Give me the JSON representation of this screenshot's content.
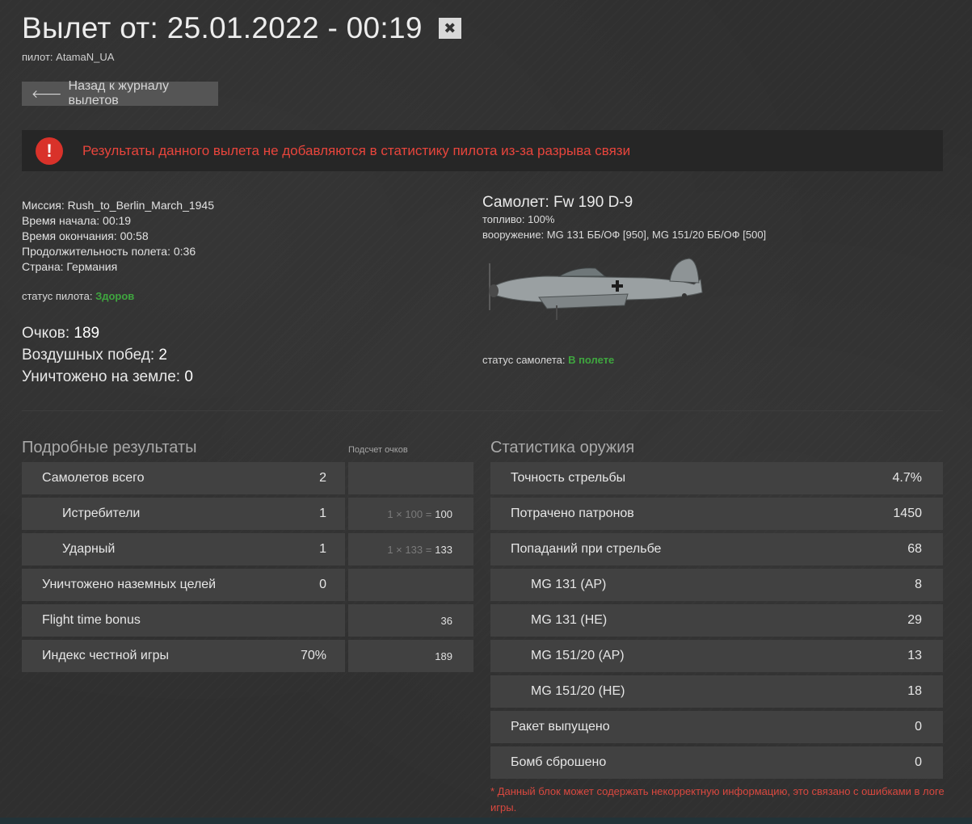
{
  "header": {
    "title": "Вылет от: 25.01.2022 - 00:19",
    "close_glyph": "✖",
    "pilot": "пилот: AtamaN_UA"
  },
  "back_button": {
    "label": "Назад к журналу вылетов",
    "icon": "arrow-left-icon"
  },
  "alert": {
    "icon": "exclamation-icon",
    "text": "Результаты данного вылета не добавляются в статистику пилота из-за разрыва связи",
    "color": "#e8453c"
  },
  "mission": {
    "lines": [
      "Миссия: Rush_to_Berlin_March_1945",
      "Время начала: 00:19",
      "Время окончания: 00:58",
      "Продолжительность полета: 0:36",
      "Страна: Германия"
    ],
    "pilot_status_label": "статус пилота: ",
    "pilot_status_value": "Здоров"
  },
  "summary": {
    "points_label": "Очков: ",
    "points_value": "189",
    "air_kills_label": "Воздушных побед: ",
    "air_kills_value": "2",
    "ground_kills_label": "Уничтожено на земле: ",
    "ground_kills_value": "0"
  },
  "plane": {
    "title": "Самолет: Fw 190 D-9",
    "fuel": "топливо: 100%",
    "armament": "вооружение: MG 131 ББ/ОФ [950], MG 151/20 ББ/ОФ [500]",
    "status_label": "статус самолета: ",
    "status_value": "В полете"
  },
  "results": {
    "title": "Подробные результаты",
    "points_header": "Подсчет очков",
    "rows": [
      {
        "label": "Самолетов всего",
        "value": "2",
        "formula": "",
        "points": ""
      },
      {
        "label": "Истребители",
        "value": "1",
        "formula": "1 × 100 =",
        "points": "100"
      },
      {
        "label": "Ударный",
        "value": "1",
        "formula": "1 × 133 =",
        "points": "133"
      },
      {
        "label": "Уничтожено наземных целей",
        "value": "0",
        "formula": "",
        "points": ""
      },
      {
        "label": "Flight time bonus",
        "value": "",
        "formula": "",
        "points": "36"
      },
      {
        "label": "Индекс честной игры",
        "value": "70%",
        "formula": "",
        "points": "189"
      }
    ]
  },
  "weapons": {
    "title": "Статистика оружия",
    "rows": [
      {
        "label": "Точность стрельбы",
        "value": "4.7%"
      },
      {
        "label": "Потрачено патронов",
        "value": "1450"
      },
      {
        "label": "Попаданий при стрельбе",
        "value": "68"
      },
      {
        "label": "MG 131 (AP)",
        "value": "8"
      },
      {
        "label": "MG 131 (HE)",
        "value": "29"
      },
      {
        "label": "MG 151/20 (AP)",
        "value": "13"
      },
      {
        "label": "MG 151/20 (HE)",
        "value": "18"
      },
      {
        "label": "Ракет выпущено",
        "value": "0"
      },
      {
        "label": "Бомб сброшено",
        "value": "0"
      }
    ],
    "footnote": "* Данный блок может содержать некорректную информацию, это связано с ошибками в логе игры."
  }
}
